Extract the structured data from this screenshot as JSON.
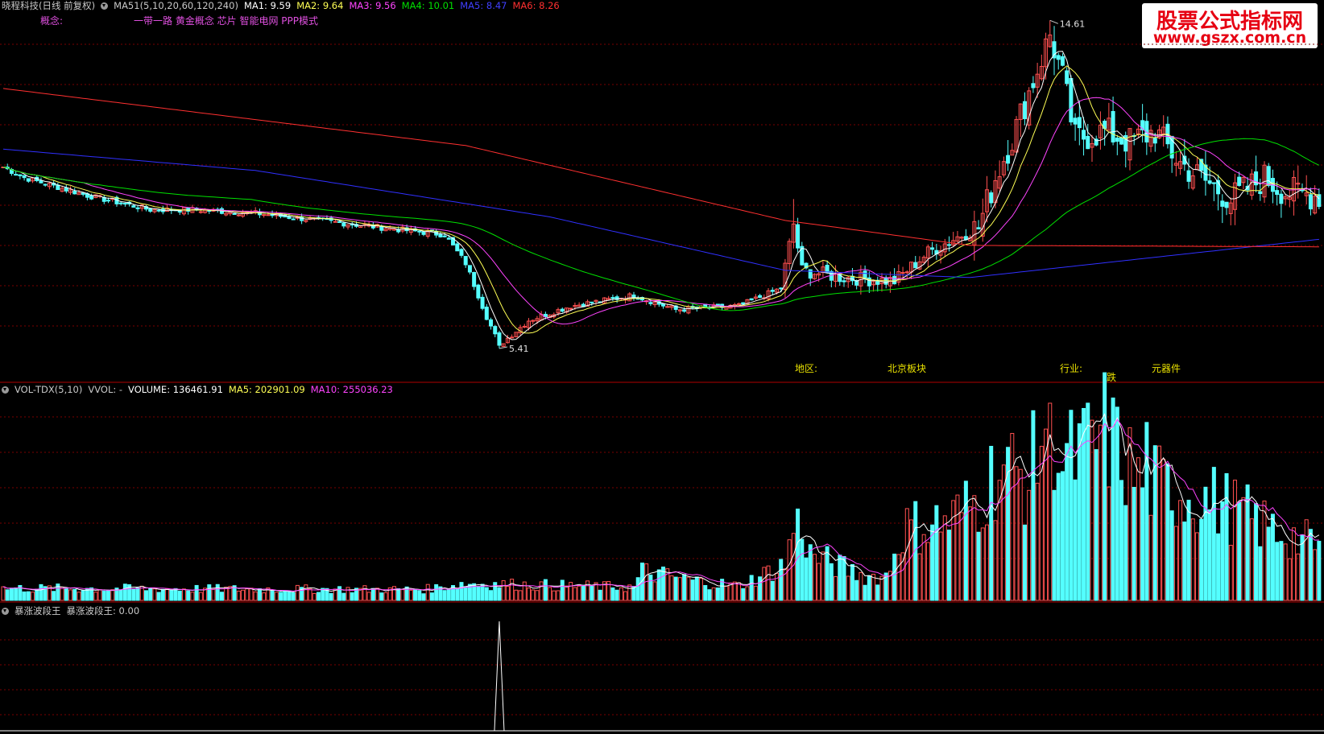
{
  "main_header": {
    "stock": "晓程科技(日线 前复权)",
    "indicator": "MA51(5,10,20,60,120,240)",
    "ma1": "MA1: 9.59",
    "ma2": "MA2: 9.64",
    "ma3": "MA3: 9.56",
    "ma4": "MA4: 10.01",
    "ma5": "MA5: 8.47",
    "ma6": "MA6: 8.26"
  },
  "concept": {
    "label": "概念:",
    "items": "一带一路 黄金概念 芯片 智能电网 PPP模式"
  },
  "region": {
    "label": "地区:",
    "value": "北京板块"
  },
  "industry": {
    "label": "行业:",
    "value": "元器件"
  },
  "marker_die": "跌",
  "vol_header": {
    "name": "VOL-TDX(5,10)",
    "vvol": "VVOL: -",
    "volume": "VOLUME: 136461.91",
    "ma5": "MA5: 202901.09",
    "ma10": "MA10: 255036.23"
  },
  "ind_header": {
    "name": "暴涨波段王",
    "value": "暴涨波段王: 0.00"
  },
  "logo": {
    "line1": "股票公式指标网",
    "line2": "www.gszx.com.cn"
  },
  "colors": {
    "up": "#ff5050",
    "down": "#54ffff",
    "ma1": "#ffffff",
    "ma2": "#ffff55",
    "ma3": "#ff44ff",
    "ma4": "#00e000",
    "ma5": "#3030ff",
    "ma6": "#ff3030",
    "grid": "#7a0000"
  },
  "chart_data": [
    {
      "type": "candlestick",
      "ylim": [
        4.8,
        15.0
      ],
      "annotations": [
        {
          "text": "14.61",
          "x": 249,
          "y": 14.61
        },
        {
          "text": "5.41",
          "x": 118,
          "y": 5.41
        }
      ],
      "anchors": {
        "close": [
          [
            0,
            10.5
          ],
          [
            5,
            10.2
          ],
          [
            20,
            9.7
          ],
          [
            35,
            9.3
          ],
          [
            45,
            9.3
          ],
          [
            60,
            9.2
          ],
          [
            75,
            9.0
          ],
          [
            90,
            8.8
          ],
          [
            105,
            8.6
          ],
          [
            110,
            7.8
          ],
          [
            115,
            6.3
          ],
          [
            118,
            5.5
          ],
          [
            125,
            6.2
          ],
          [
            135,
            6.6
          ],
          [
            150,
            6.9
          ],
          [
            160,
            6.5
          ],
          [
            175,
            6.6
          ],
          [
            185,
            7.1
          ],
          [
            188,
            8.9
          ],
          [
            190,
            7.6
          ],
          [
            200,
            7.4
          ],
          [
            212,
            7.3
          ],
          [
            220,
            8.1
          ],
          [
            228,
            8.6
          ],
          [
            232,
            8.8
          ],
          [
            236,
            10.2
          ],
          [
            240,
            11.3
          ],
          [
            244,
            12.6
          ],
          [
            249,
            14.2
          ],
          [
            252,
            13.0
          ],
          [
            255,
            11.3
          ],
          [
            262,
            11.5
          ],
          [
            268,
            11.2
          ],
          [
            274,
            11.5
          ],
          [
            280,
            10.6
          ],
          [
            286,
            10.1
          ],
          [
            292,
            9.6
          ],
          [
            300,
            10.2
          ],
          [
            305,
            9.8
          ],
          [
            313,
            9.7
          ]
        ]
      },
      "moving_averages": [
        {
          "name": "MA1",
          "period": 5
        },
        {
          "name": "MA2",
          "period": 10
        },
        {
          "name": "MA3",
          "period": 20
        },
        {
          "name": "MA4",
          "period": 60
        },
        {
          "name": "MA5",
          "period": 120
        },
        {
          "name": "MA6",
          "period": 240
        }
      ],
      "ma6_anchors": [
        [
          0,
          12.7
        ],
        [
          110,
          11.1
        ],
        [
          186,
          9.0
        ],
        [
          230,
          8.3
        ],
        [
          313,
          8.26
        ]
      ],
      "ma5_anchors": [
        [
          0,
          11.0
        ],
        [
          60,
          10.4
        ],
        [
          130,
          9.1
        ],
        [
          186,
          7.6
        ],
        [
          230,
          7.4
        ],
        [
          313,
          8.47
        ]
      ]
    },
    {
      "type": "bar",
      "name": "VOLUME",
      "ylim": [
        0,
        850000
      ],
      "anchors": [
        [
          0,
          50000
        ],
        [
          100,
          45000
        ],
        [
          110,
          70000
        ],
        [
          150,
          55000
        ],
        [
          152,
          120000
        ],
        [
          165,
          80000
        ],
        [
          175,
          60000
        ],
        [
          186,
          150000
        ],
        [
          189,
          380000
        ],
        [
          192,
          190000
        ],
        [
          205,
          100000
        ],
        [
          210,
          100000
        ],
        [
          214,
          300000
        ],
        [
          225,
          330000
        ],
        [
          232,
          420000
        ],
        [
          237,
          560000
        ],
        [
          244,
          500000
        ],
        [
          249,
          820000
        ],
        [
          252,
          560000
        ],
        [
          260,
          650000
        ],
        [
          262,
          700000
        ],
        [
          270,
          500000
        ],
        [
          290,
          400000
        ],
        [
          300,
          310000
        ],
        [
          313,
          220000
        ]
      ]
    },
    {
      "type": "line",
      "name": "暴涨波段王",
      "ylim": [
        0,
        1
      ],
      "spike_x": 118,
      "spike_value": 1
    }
  ]
}
